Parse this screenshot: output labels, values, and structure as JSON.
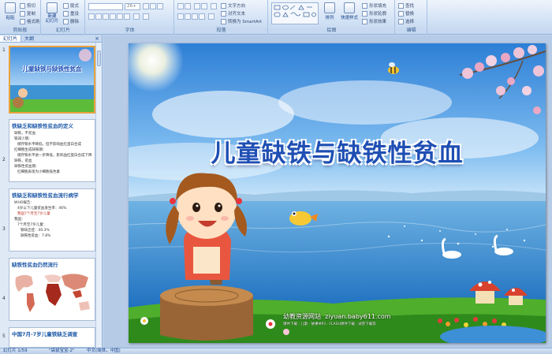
{
  "ribbon": {
    "clipboard": {
      "group_label": "剪贴板",
      "paste": "粘贴",
      "cut": "剪切",
      "copy": "复制",
      "format_painter": "格式刷"
    },
    "slides": {
      "group_label": "幻灯片",
      "new_slide": "新建\n幻灯片",
      "layout": "版式",
      "reset": "重设",
      "delete": "删除"
    },
    "font": {
      "group_label": "字体",
      "size": "26+"
    },
    "paragraph": {
      "group_label": "段落",
      "text_direction": "文字方向",
      "align_text": "对齐文本",
      "smartart": "转换为 SmartArt"
    },
    "drawing": {
      "group_label": "绘图",
      "arrange": "排列",
      "quick_styles": "快速样式",
      "shape_fill": "形状填充",
      "shape_outline": "形状轮廓",
      "shape_effects": "形状效果"
    },
    "editing": {
      "group_label": "编辑",
      "find": "查找",
      "replace": "替换",
      "select": "选择"
    }
  },
  "panel": {
    "tab_slides": "幻灯片",
    "tab_outline": "大纲",
    "close": "×",
    "thumbs": [
      {
        "num": "1",
        "title": "儿童缺铁与缺铁性贫血"
      },
      {
        "num": "2",
        "title": "铁缺乏和缺铁性贫血的定义",
        "lines": [
          "缺铁，不贫血",
          "铁减少期：",
          "储存铁水平降低，但不影响血红蛋白合成",
          "红细胞生成缺铁期：",
          "储存铁水平进一步降低，影响血红蛋白合成下降",
          "缺铁，贫血",
          "缺铁性贫血期：",
          "红细胞表现为小细胞低色素"
        ]
      },
      {
        "num": "3",
        "title": "铁缺乏和缺铁性贫血流行病学",
        "lines": [
          "WHO报告：",
          "4岁以下儿童贫血发生率：46%",
          "我国7个月至7岁儿童",
          "我国：",
          "7个月至7岁儿童：",
          "铁缺乏症：40.3%",
          "缺铁性贫血：7.8%"
        ]
      },
      {
        "num": "4",
        "title": "缺铁性贫血仍然流行"
      },
      {
        "num": "5",
        "title": "中国7月-7岁儿童铁缺乏调查"
      }
    ]
  },
  "slide": {
    "title": "儿童缺铁与缺铁性贫血",
    "site_name": "幼教资源网站",
    "site_url": "ziyuan.baby611.com",
    "site_tagline": "课件下载 · 儿歌 · 故事MP3 · FLASH课件下载 · 试卷下载等"
  },
  "status": {
    "slide_info": "幻灯片 1/59",
    "theme": "\"袋鼠宝宝-2\"",
    "language": "中文(简体，中国)"
  },
  "colors": {
    "ribbon_bg": "#d3e2f5",
    "title_text": "#1f4fb4",
    "selected_thumb_border": "#e8a33c"
  }
}
